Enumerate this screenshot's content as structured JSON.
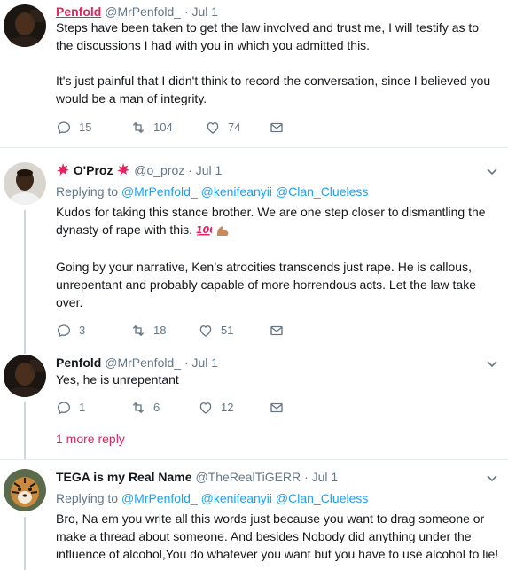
{
  "tweets": [
    {
      "name": "Penfold",
      "handle": "@MrPenfold_",
      "dot": "·",
      "date": "Jul 1",
      "paragraphs": [
        "Steps have been taken to get the law involved and trust me, I will testify as to the discussions I had with you in which you admitted this.",
        "It's just painful that I didn't think to record the conversation, since I believed you would be a man of integrity."
      ],
      "replies": "15",
      "retweets": "104",
      "likes": "74"
    },
    {
      "name": "O'Proz",
      "handle": "@o_proz",
      "dot": "·",
      "date": "Jul 1",
      "replying_prefix": "Replying to",
      "mentions": [
        "@MrPenfold_",
        "@kenifeanyii",
        "@Clan_Clueless"
      ],
      "paragraphs": [
        "Kudos for taking this stance brother. We are one step closer to dismantling the dynasty of rape with this.",
        "Going by your narrative, Ken’s atrocities transcends just rape. He is callous, unrepentant and probably capable of more horrendous acts. Let the law take over."
      ],
      "replies": "3",
      "retweets": "18",
      "likes": "51"
    },
    {
      "name": "Penfold",
      "handle": "@MrPenfold_",
      "dot": "·",
      "date": "Jul 1",
      "paragraphs": [
        "Yes, he is unrepentant"
      ],
      "replies": "1",
      "retweets": "6",
      "likes": "12"
    },
    {
      "name": "TEGA is my Real Name",
      "handle": "@TheRealTiGERR",
      "dot": "·",
      "date": "Jul 1",
      "replying_prefix": "Replying to",
      "mentions": [
        "@MrPenfold_",
        "@kenifeanyii",
        "@Clan_Clueless"
      ],
      "paragraphs": [
        "Bro, Na em you write all this words just because you want to drag someone or make a thread about someone. And besides Nobody did anything under the influence of alcohol,You do whatever you want but you have to use alcohol to lie!"
      ]
    }
  ],
  "more_reply": "1 more reply",
  "colors": {
    "accent": "#1da1f2",
    "red": "#e0245e",
    "muted": "#657786",
    "text": "#14171a",
    "border": "#e6ecf0"
  },
  "icons": [
    "reply-icon",
    "retweet-icon",
    "like-icon",
    "message-icon",
    "chevron-down-icon",
    "hundred-emoji",
    "flexed-bicep-emoji",
    "collision-emoji"
  ]
}
